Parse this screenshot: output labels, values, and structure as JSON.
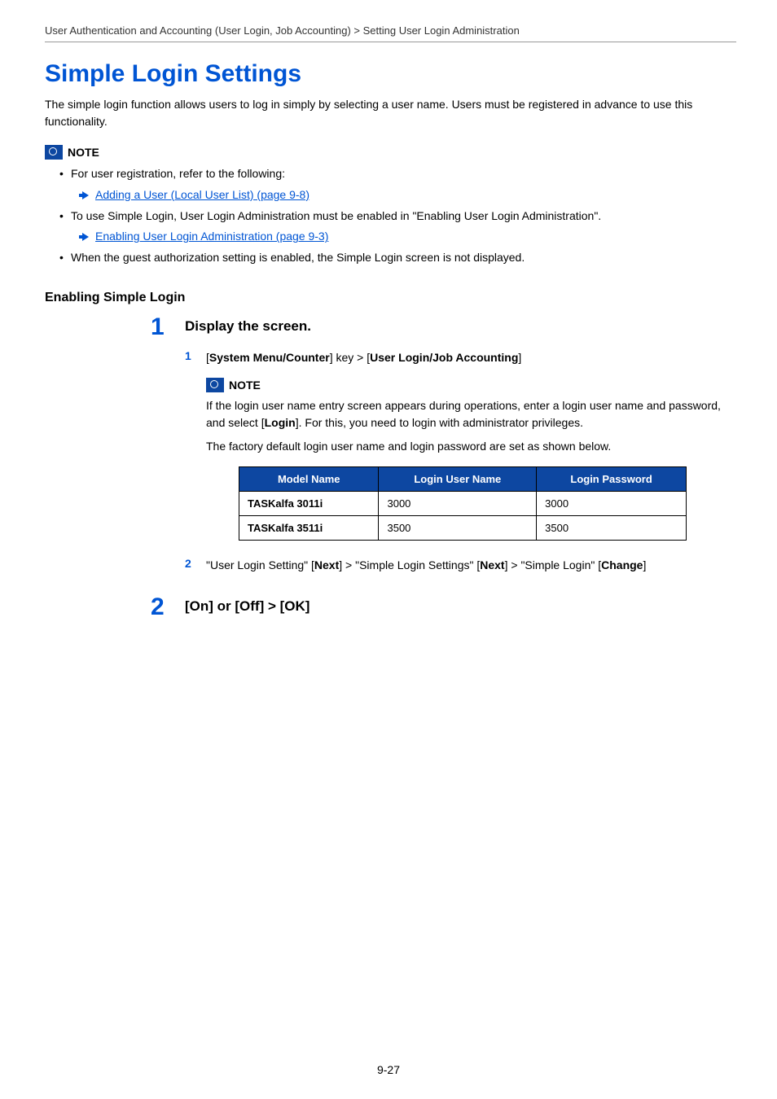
{
  "breadcrumb": "User Authentication and Accounting (User Login, Job Accounting) > Setting User Login Administration",
  "title": "Simple Login Settings",
  "intro": "The simple login function allows users to log in simply by selecting a user name. Users must be registered in advance to use this functionality.",
  "note_label": "NOTE",
  "notes": {
    "n1": "For user registration, refer to the following:",
    "xref1": "Adding a User (Local User List) (page 9-8)",
    "n2": "To use Simple Login, User Login Administration must be enabled in \"Enabling User Login Administration\".",
    "xref2": "Enabling User Login Administration (page 9-3)",
    "n3": "When the guest authorization setting is enabled, the Simple Login screen is not displayed."
  },
  "section": "Enabling Simple Login",
  "step1": {
    "num": "1",
    "title": "Display the screen.",
    "sub1_num": "1",
    "sub1_prefix": "[",
    "sub1_bold1": "System Menu/Counter",
    "sub1_mid": "] key > [",
    "sub1_bold2": "User Login/Job Accounting",
    "sub1_suffix": "]",
    "note_label": "NOTE",
    "note_p1a": "If the login user name entry screen appears during operations, enter a login user name and password, and select [",
    "note_p1b": "Login",
    "note_p1c": "]. For this, you need to login with administrator privileges.",
    "note_p2": "The factory default login user name and login password are set as shown below.",
    "table": {
      "headers": [
        "Model Name",
        "Login User Name",
        "Login Password"
      ],
      "rows": [
        [
          "TASKalfa 3011i",
          "3000",
          "3000"
        ],
        [
          "TASKalfa 3511i",
          "3500",
          "3500"
        ]
      ]
    },
    "sub2_num": "2",
    "sub2_a": "\"User Login Setting\" [",
    "sub2_b1": "Next",
    "sub2_c": "] > \"Simple Login Settings\" [",
    "sub2_b2": "Next",
    "sub2_d": "] > \"Simple Login\" [",
    "sub2_b3": "Change",
    "sub2_e": "]"
  },
  "step2": {
    "num": "2",
    "title": "[On] or [Off] > [OK]"
  },
  "page_number": "9-27"
}
